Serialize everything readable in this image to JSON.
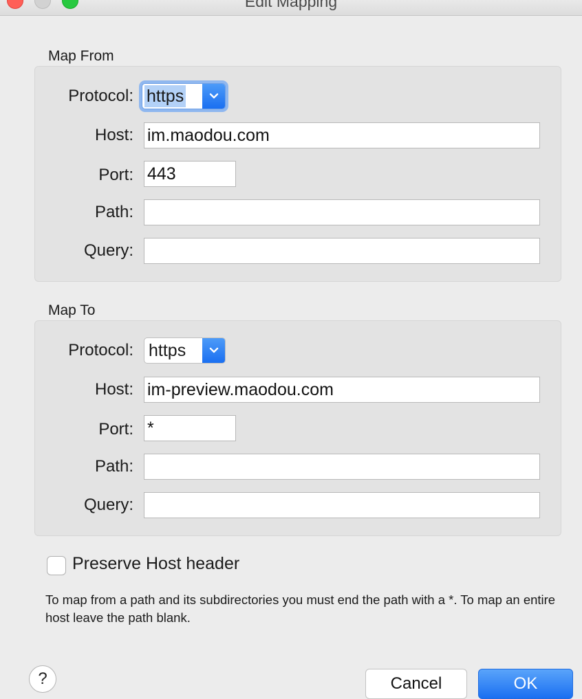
{
  "window": {
    "title": "Edit Mapping"
  },
  "map_from": {
    "label": "Map From",
    "protocol_label": "Protocol:",
    "protocol_value": "https",
    "host_label": "Host:",
    "host_value": "im.maodou.com",
    "port_label": "Port:",
    "port_value": "443",
    "path_label": "Path:",
    "path_value": "",
    "query_label": "Query:",
    "query_value": ""
  },
  "map_to": {
    "label": "Map To",
    "protocol_label": "Protocol:",
    "protocol_value": "https",
    "host_label": "Host:",
    "host_value": "im-preview.maodou.com",
    "port_label": "Port:",
    "port_value": "*",
    "path_label": "Path:",
    "path_value": "",
    "query_label": "Query:",
    "query_value": ""
  },
  "preserve_host": {
    "label": "Preserve Host header",
    "checked": false
  },
  "note": "To map from a path and its subdirectories you must end the path with a *. To map an entire host leave the path blank.",
  "buttons": {
    "help": "?",
    "cancel": "Cancel",
    "ok": "OK"
  },
  "icons": {
    "dropdown": "chevron-down-icon",
    "help": "question-mark-icon"
  },
  "colors": {
    "accent": "#1a6ff1",
    "focus_ring": "#8fb7ef",
    "window_bg": "#ececec"
  }
}
